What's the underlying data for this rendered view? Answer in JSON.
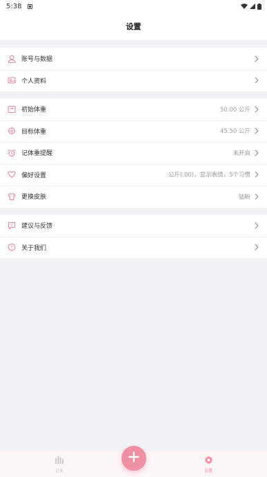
{
  "status_bar": {
    "time": "5:38"
  },
  "header": {
    "title": "设置"
  },
  "groups": [
    {
      "items": [
        {
          "label": "账号与数据",
          "value": "",
          "icon": "person-icon"
        },
        {
          "label": "个人资料",
          "value": "",
          "icon": "profile-card-icon"
        }
      ]
    },
    {
      "items": [
        {
          "label": "初始体重",
          "value": "50.00 公斤",
          "icon": "scale-icon"
        },
        {
          "label": "目标体重",
          "value": "45.50 公斤",
          "icon": "target-icon"
        },
        {
          "label": "记体重提醒",
          "value": "未开启",
          "icon": "alarm-clock-icon"
        },
        {
          "label": "偏好设置",
          "value": "公斤(.00)，显示表情，5个习惯",
          "icon": "heart-icon"
        },
        {
          "label": "更换皮肤",
          "value": "猛粉",
          "icon": "shirt-icon"
        }
      ]
    },
    {
      "items": [
        {
          "label": "建议与反馈",
          "value": "",
          "icon": "feedback-icon"
        },
        {
          "label": "关于我们",
          "value": "",
          "icon": "info-icon"
        }
      ]
    }
  ],
  "tabbar": {
    "left_label": "记录",
    "right_label": "设置"
  },
  "colors": {
    "accent": "#ef8fa3",
    "icon": "#e8899c",
    "background": "#f2f2f6",
    "muted": "#9a9a9a"
  }
}
